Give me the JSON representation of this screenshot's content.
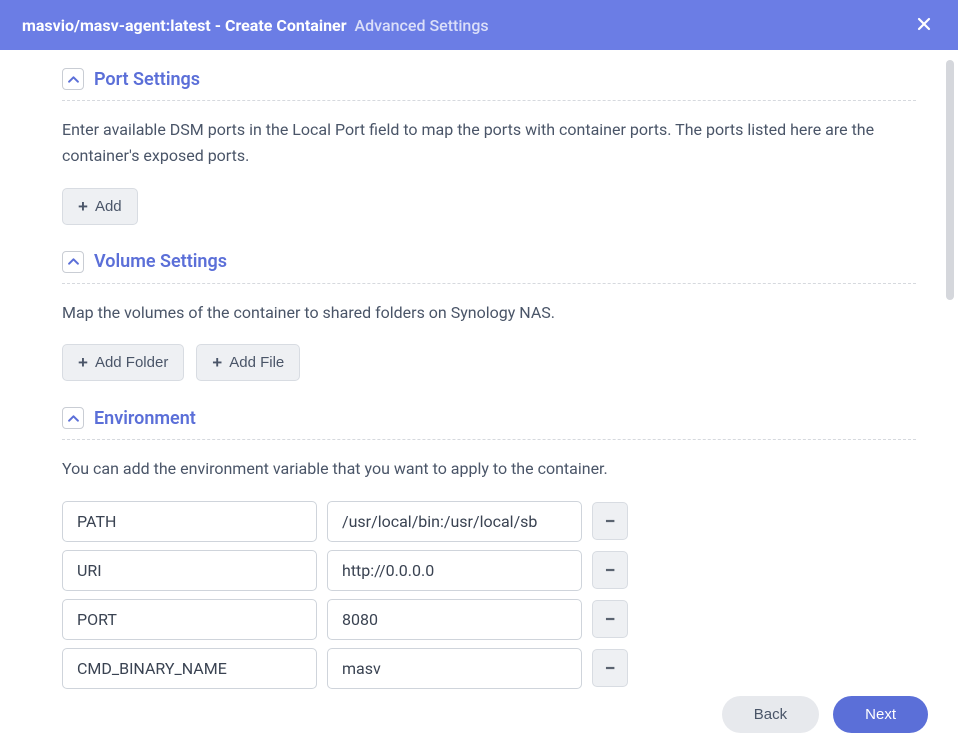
{
  "header": {
    "image": "masvio/masv-agent:latest",
    "action": "Create Container",
    "subtitle": "Advanced Settings"
  },
  "sections": {
    "port": {
      "title": "Port Settings",
      "desc": "Enter available DSM ports in the Local Port field to map the ports with container ports. The ports listed here are the container's exposed ports.",
      "add_label": "Add"
    },
    "volume": {
      "title": "Volume Settings",
      "desc": "Map the volumes of the container to shared folders on Synology NAS.",
      "add_folder_label": "Add Folder",
      "add_file_label": "Add File"
    },
    "env": {
      "title": "Environment",
      "desc": "You can add the environment variable that you want to apply to the container.",
      "vars": [
        {
          "key": "PATH",
          "value": "/usr/local/bin:/usr/local/sb"
        },
        {
          "key": "URI",
          "value": "http://0.0.0.0"
        },
        {
          "key": "PORT",
          "value": "8080"
        },
        {
          "key": "CMD_BINARY_NAME",
          "value": "masv"
        }
      ]
    }
  },
  "footer": {
    "back_label": "Back",
    "next_label": "Next"
  }
}
